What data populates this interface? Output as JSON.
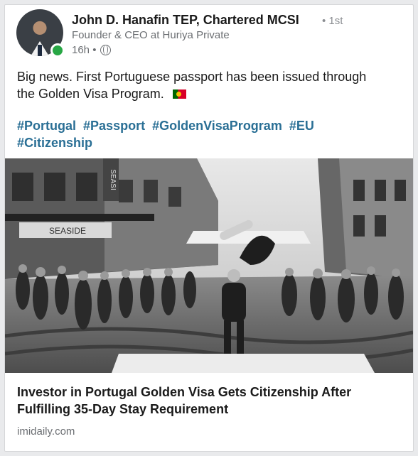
{
  "post": {
    "author_name": "John D. Hanafin TEP, Chartered MCSI",
    "degree": "• 1st",
    "headline": "Founder & CEO at Huriya Private",
    "time": "16h •",
    "text": "Big news. First Portuguese passport has been issued through the Golden Visa Program.",
    "hashtags": [
      "#Portugal",
      "#Passport",
      "#GoldenVisaProgram",
      "#EU",
      "#Citizenship"
    ]
  },
  "link": {
    "title": "Investor in Portugal Golden Visa Gets Citizenship After Fulfilling 35-Day Stay Requirement",
    "source": "imidaily.com"
  },
  "image": {
    "description_icons": [
      "street-photo"
    ],
    "signs": [
      "SEASIDE",
      "SEASI"
    ]
  },
  "colors": {
    "hashtag": "#2a6f95",
    "online": "#28a745",
    "text": "#1a1a1a",
    "muted": "#6b6e72"
  }
}
